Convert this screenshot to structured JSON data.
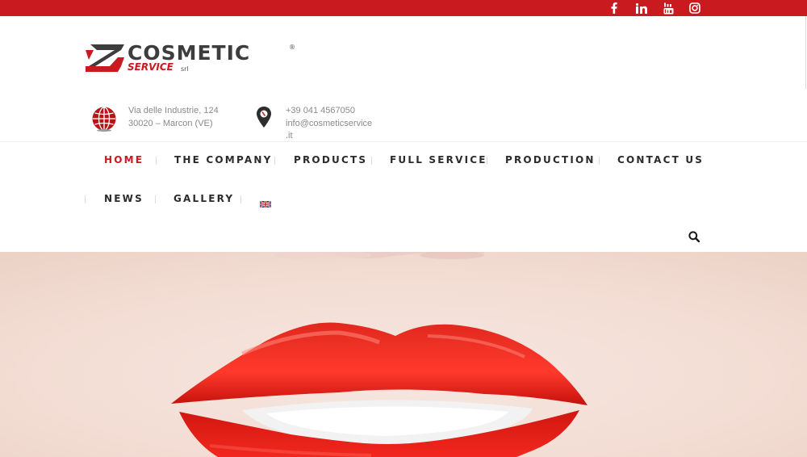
{
  "topbar": {
    "color": "#c81a1f",
    "social_icons": [
      "facebook-icon",
      "linkedin-icon",
      "youtube-icon",
      "instagram-icon"
    ]
  },
  "logo": {
    "name": "COSMETIC",
    "registered": "®",
    "sub": "SERVICE",
    "suffix": "srl"
  },
  "contact": {
    "address_line1": "Via delle Industrie, 124",
    "address_line2": "30020 – Marcon (VE)",
    "phone": "+39 041 4567050",
    "email_line1": "info@cosmeticservice",
    "email_line2": ".it"
  },
  "nav": {
    "home": "HOME",
    "company": "THE COMPANY",
    "products": "PRODUCTS",
    "full_service": "FULL SERVICE",
    "production": "PRODUCTION",
    "contact": "CONTACT US",
    "news": "NEWS",
    "gallery": "GALLERY"
  },
  "colors": {
    "accent": "#c81a1f",
    "nav_text": "#2b2b2b",
    "info_text": "#8a8a8a"
  },
  "hero": {
    "image": "red-lips-photo"
  }
}
